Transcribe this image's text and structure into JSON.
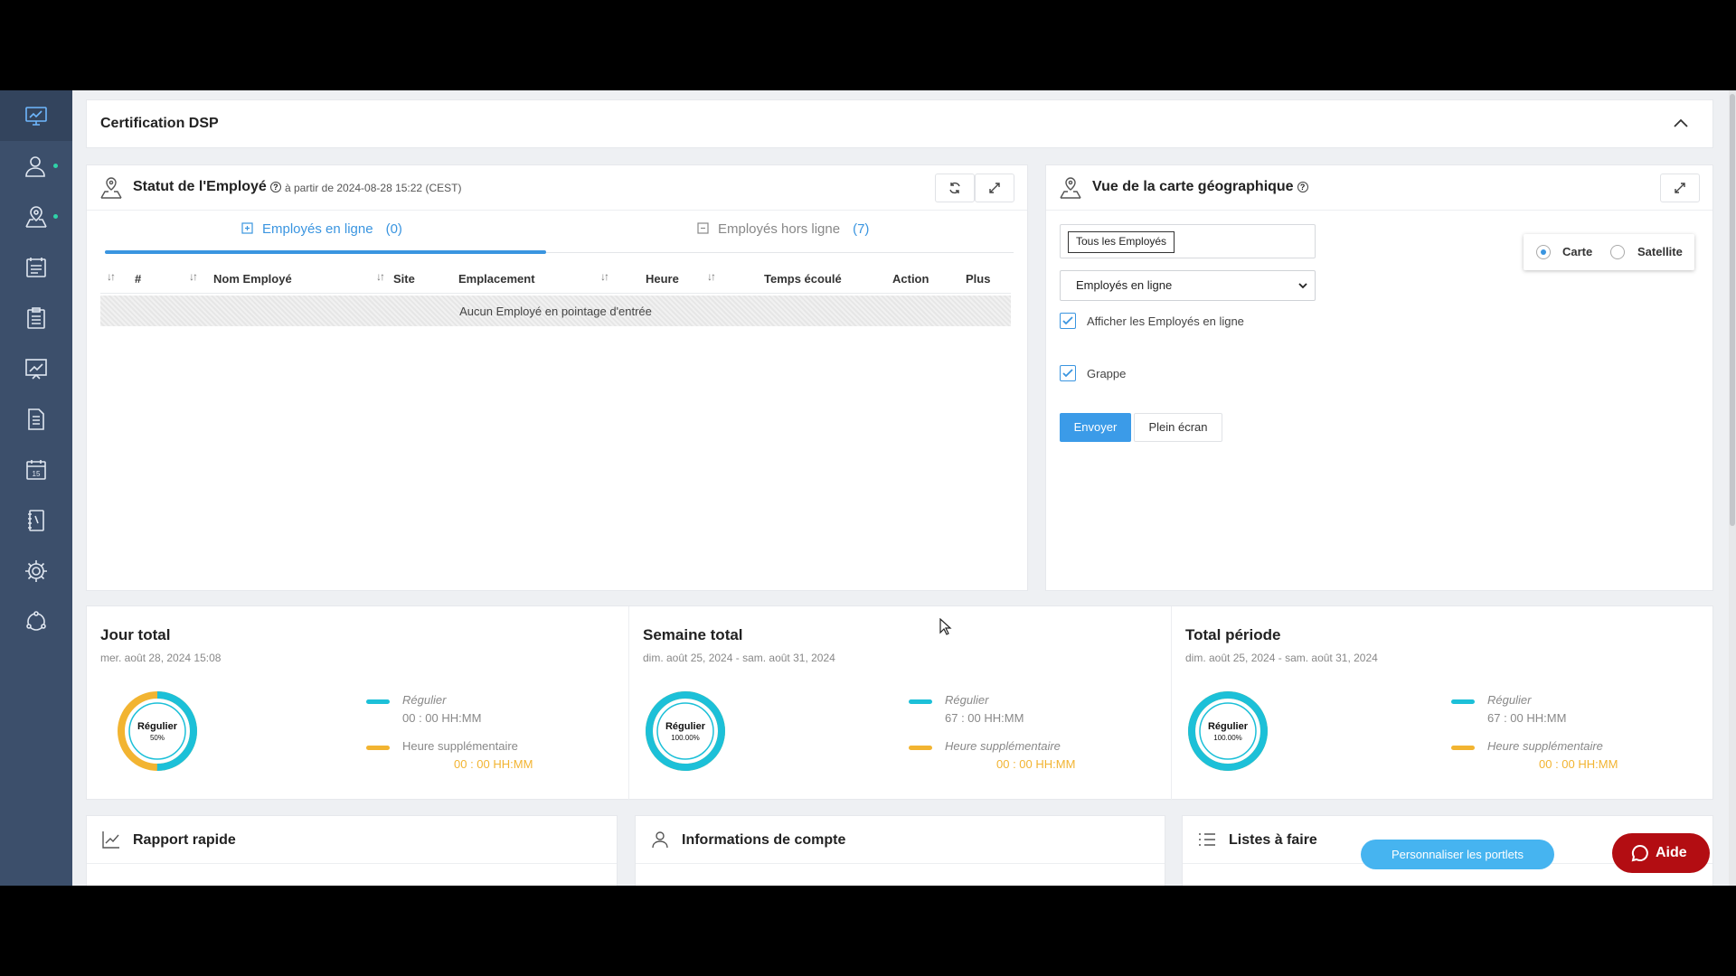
{
  "sidebar": {
    "items": [
      {
        "icon": "dashboard-chart-icon",
        "active": true,
        "dot": false
      },
      {
        "icon": "users-icon",
        "active": false,
        "dot": true
      },
      {
        "icon": "map-user-icon",
        "active": false,
        "dot": true
      },
      {
        "icon": "timesheet-icon",
        "active": false,
        "dot": false
      },
      {
        "icon": "clipboard-list-icon",
        "active": false,
        "dot": false
      },
      {
        "icon": "report-chart-icon",
        "active": false,
        "dot": false
      },
      {
        "icon": "document-icon",
        "active": false,
        "dot": false
      },
      {
        "icon": "calendar-icon",
        "active": false,
        "dot": false
      },
      {
        "icon": "notebook-icon",
        "active": false,
        "dot": false
      },
      {
        "icon": "settings-gear-icon",
        "active": false,
        "dot": false
      },
      {
        "icon": "integrations-icon",
        "active": false,
        "dot": false
      }
    ],
    "calendar_day": "15"
  },
  "certification": {
    "title": "Certification DSP"
  },
  "employee_status": {
    "title": "Statut de l'Employé",
    "info": "?",
    "subtitle": "à partir de 2024-08-28 15:22  (CEST)",
    "tabs": [
      {
        "label": "Employés en ligne",
        "count": "(0)",
        "active": true
      },
      {
        "label": "Employés hors ligne",
        "count": "(7)",
        "active": false
      }
    ],
    "columns": [
      "#",
      "Nom Employé",
      "Site",
      "Emplacement",
      "Heure",
      "Temps écoulé",
      "Action",
      "Plus"
    ],
    "sort_symbol": "↓↑",
    "empty_message": "Aucun Employé en pointage d'entrée"
  },
  "geo_map": {
    "title": "Vue de la carte géographique",
    "info": "?",
    "employee_filter_tag": "Tous les Employés",
    "status_select": "Employés en ligne",
    "show_online_label": "Afficher les Employés en ligne",
    "show_online_checked": true,
    "cluster_label": "Grappe",
    "cluster_checked": true,
    "submit_label": "Envoyer",
    "fullscreen_label": "Plein écran",
    "map_types": [
      {
        "label": "Carte",
        "selected": true
      },
      {
        "label": "Satellite",
        "selected": false
      }
    ]
  },
  "totals": [
    {
      "title": "Jour total",
      "date": "mer. août 28, 2024 15:08",
      "donut_label": "Régulier",
      "donut_pct": "50%",
      "regular_fraction": 0.5,
      "regular_label": "Régulier",
      "regular_value": "00 : 00 HH:MM",
      "overtime_label": "Heure supplémentaire",
      "overtime_value": "00 : 00 HH:MM"
    },
    {
      "title": "Semaine total",
      "date": "dim. août 25, 2024 - sam. août 31, 2024",
      "donut_label": "Régulier",
      "donut_pct": "100.00%",
      "regular_fraction": 1.0,
      "regular_label": "Régulier",
      "regular_value": "67 : 00 HH:MM",
      "overtime_label": "Heure supplémentaire",
      "overtime_value": "00 : 00 HH:MM"
    },
    {
      "title": "Total période",
      "date": "dim. août 25, 2024 - sam. août 31, 2024",
      "donut_label": "Régulier",
      "donut_pct": "100.00%",
      "regular_fraction": 1.0,
      "regular_label": "Régulier",
      "regular_value": "67 : 00 HH:MM",
      "overtime_label": "Heure supplémentaire",
      "overtime_value": "00 : 00 HH:MM"
    }
  ],
  "bottom_cards": [
    {
      "title": "Rapport rapide",
      "icon": "chart-line-icon"
    },
    {
      "title": "Informations de compte",
      "icon": "user-icon"
    },
    {
      "title": "Listes à faire",
      "icon": "list-icon"
    }
  ],
  "customize_portlets_label": "Personnaliser les portlets",
  "help_label": "Aide",
  "colors": {
    "sidebar_bg": "#3c4f6b",
    "accent_blue": "#3a95e0",
    "regular_cyan": "#1cc0d8",
    "overtime_orange": "#f2b431",
    "help_red": "#b30d12"
  }
}
